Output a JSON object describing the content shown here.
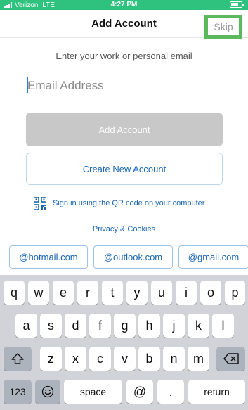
{
  "status_bar": {
    "carrier": "Verizon",
    "network": "LTE",
    "time": "4:27 PM"
  },
  "header": {
    "title": "Add Account",
    "skip_label": "Skip"
  },
  "form": {
    "instruction": "Enter your work or personal email",
    "email_placeholder": "Email Address",
    "add_account_label": "Add Account",
    "create_account_label": "Create New Account",
    "qr_label": "Sign in using the QR code on your computer",
    "privacy_label": "Privacy & Cookies"
  },
  "suggestions": [
    "@hotmail.com",
    "@outlook.com",
    "@gmail.com"
  ],
  "keyboard": {
    "row1": [
      "q",
      "w",
      "e",
      "r",
      "t",
      "y",
      "u",
      "i",
      "o",
      "p"
    ],
    "row2": [
      "a",
      "s",
      "d",
      "f",
      "g",
      "h",
      "j",
      "k",
      "l"
    ],
    "row3": [
      "z",
      "x",
      "c",
      "v",
      "b",
      "n",
      "m"
    ],
    "numbers_label": "123",
    "space_label": "space",
    "at_label": "@",
    "dot_label": ".",
    "return_label": "return",
    "shift_icon": "shift-icon",
    "delete_icon": "delete-icon",
    "emoji_icon": "emoji-icon"
  },
  "colors": {
    "status_green": "#2ec27e",
    "skip_highlight": "#5cb85c",
    "link_blue": "#1a66b3"
  }
}
